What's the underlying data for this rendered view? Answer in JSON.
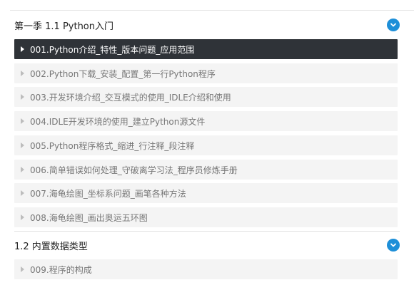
{
  "sections": [
    {
      "title": "第一季 1.1 Python入门",
      "toggle_icon": "chevron-down-icon",
      "lessons": [
        {
          "label": "001.Python介绍_特性_版本问题_应用范围",
          "active": true
        },
        {
          "label": "002.Python下载_安装_配置_第一行Python程序",
          "active": false
        },
        {
          "label": "003.开发环境介绍_交互模式的使用_IDLE介绍和使用",
          "active": false
        },
        {
          "label": "004.IDLE开发环境的使用_建立Python源文件",
          "active": false
        },
        {
          "label": "005.Python程序格式_缩进_行注释_段注释",
          "active": false
        },
        {
          "label": "006.简单错误如何处理_守破离学习法_程序员修炼手册",
          "active": false
        },
        {
          "label": "007.海龟绘图_坐标系问题_画笔各种方法",
          "active": false
        },
        {
          "label": "008.海龟绘图_画出奥运五环图",
          "active": false
        }
      ]
    },
    {
      "title": "1.2 内置数据类型",
      "toggle_icon": "chevron-down-icon",
      "lessons": [
        {
          "label": "009.程序的构成",
          "active": false
        }
      ]
    }
  ],
  "colors": {
    "accent": "#1e8fd8",
    "active_row": "#2f3338",
    "row": "#f4f4f4"
  }
}
